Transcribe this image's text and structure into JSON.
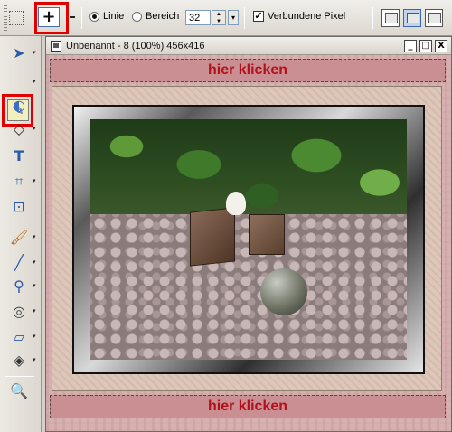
{
  "toolbar": {
    "mode_plus_symbol": "+",
    "radio_line_label": "Linie",
    "radio_area_label": "Bereich",
    "size_value": "32",
    "connected_pixels_label": "Verbundene Pixel",
    "connected_pixels_checked": true,
    "line_selected": true
  },
  "tools": {
    "selected": "magic-wand-icon",
    "items": [
      "pointer-icon",
      "magic-wand-icon",
      "shapes-icon",
      "text-icon",
      "crop-icon",
      "straighten-icon",
      "paint-brush-icon",
      "brush-icon",
      "clone-stamp-icon",
      "dodge-icon",
      "eraser-icon",
      "fill-icon",
      "zoom-icon"
    ]
  },
  "document": {
    "title": "Unbenannt - 8 (100%) 456x416",
    "minimize_symbol": "_",
    "restore_symbol": "□",
    "close_symbol": "X"
  },
  "canvas": {
    "top_banner_text": "hier klicken",
    "bottom_banner_text": "hier klicken"
  },
  "colors": {
    "highlight_red": "#e00000",
    "banner_text": "#b3101c",
    "banner_bg": "#c98f92"
  }
}
